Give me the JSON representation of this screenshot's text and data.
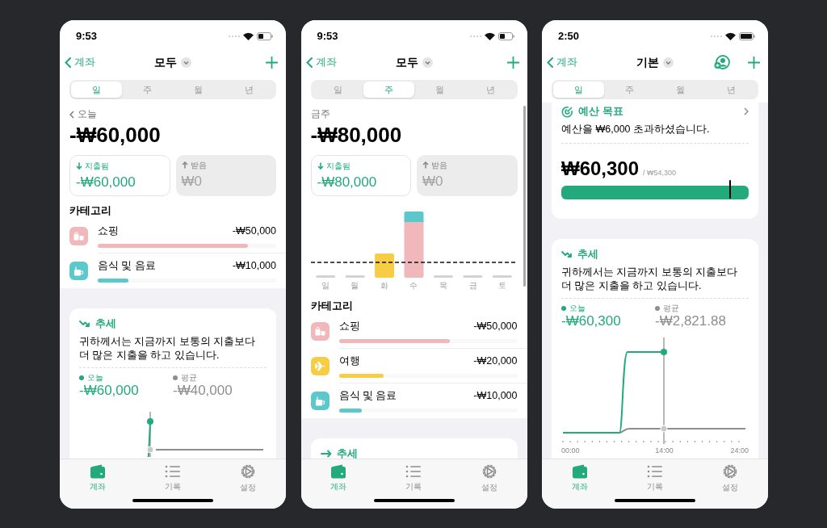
{
  "phones": [
    {
      "status_time": "9:53",
      "battery_full": false,
      "nav": {
        "back": "계좌",
        "title": "모두"
      },
      "segments": [
        {
          "label": "일",
          "selected": true
        },
        {
          "label": "주",
          "selected": false
        },
        {
          "label": "월",
          "selected": false
        },
        {
          "label": "년",
          "selected": false
        }
      ],
      "sections": [
        {
          "kind": "summary",
          "period": "오늘",
          "period_chevron": true,
          "total": "-₩60,000",
          "spent": {
            "label": "지출됨",
            "value": "-₩60,000"
          },
          "received": {
            "label": "받음",
            "value": "₩0"
          }
        },
        {
          "kind": "categories",
          "title": "카테고리",
          "items": [
            {
              "kind": "shopping",
              "name": "쇼핑",
              "amount": "-₩50,000",
              "level": 0.84,
              "color": "#f0b8bb"
            },
            {
              "kind": "food",
              "name": "음식 및 음료",
              "amount": "-₩10,000",
              "level": 0.17,
              "color": "#5cc8cc"
            }
          ]
        },
        {
          "kind": "trend",
          "icon": {
            "kind": "falling"
          },
          "title": "추세",
          "message": "귀하께서는 지금까지 보통의 지출보다 더 많은 지출을 하고 있습니다.",
          "today": {
            "label": "오늘",
            "value": "-₩60,000"
          },
          "average": {
            "label": "평균",
            "value": "-₩40,000"
          },
          "chart": {
            "kind": "spike"
          }
        }
      ],
      "tabs": [
        {
          "label": "계좌",
          "selected": true
        },
        {
          "label": "기록",
          "selected": false
        },
        {
          "label": "설정",
          "selected": false
        }
      ]
    },
    {
      "status_time": "9:53",
      "battery_full": false,
      "scrollbar_visible": true,
      "nav": {
        "back": "계좌",
        "title": "모두"
      },
      "segments": [
        {
          "label": "일",
          "selected": false
        },
        {
          "label": "주",
          "selected": true
        },
        {
          "label": "월",
          "selected": false
        },
        {
          "label": "년",
          "selected": false
        }
      ],
      "sections": [
        {
          "kind": "summary",
          "period": "금주",
          "total": "-₩80,000",
          "spent": {
            "label": "지출됨",
            "value": "-₩80,000"
          },
          "received": {
            "label": "받음",
            "value": "₩0"
          }
        },
        {
          "kind": "week_chart",
          "days": [
            "일",
            "월",
            "화",
            "수",
            "목",
            "금",
            "토"
          ]
        },
        {
          "kind": "categories",
          "title": "카테고리",
          "items": [
            {
              "kind": "shopping",
              "name": "쇼핑",
              "amount": "-₩50,000",
              "level": 0.62,
              "color": "#f0b8bb"
            },
            {
              "kind": "travel",
              "name": "여행",
              "amount": "-₩20,000",
              "level": 0.25,
              "color": "#f7cd45"
            },
            {
              "kind": "food",
              "name": "음식 및 음료",
              "amount": "-₩10,000",
              "level": 0.13,
              "color": "#5cc8cc"
            }
          ]
        },
        {
          "kind": "trend",
          "icon": {
            "kind": "flat"
          },
          "title": "추세"
        }
      ],
      "tabs": [
        {
          "label": "계좌",
          "selected": true
        },
        {
          "label": "기록",
          "selected": false
        },
        {
          "label": "설정",
          "selected": false
        }
      ]
    },
    {
      "status_time": "2:50",
      "battery_full": true,
      "nav": {
        "back": "계좌",
        "title": "기본",
        "person_button": true
      },
      "segments": [
        {
          "label": "일",
          "selected": true
        },
        {
          "label": "주",
          "selected": false
        },
        {
          "label": "월",
          "selected": false
        },
        {
          "label": "년",
          "selected": false
        }
      ],
      "sections": [
        {
          "kind": "budget",
          "title": "예산 목표",
          "message": "예산을 ₩6,000 초과하셨습니다.",
          "spent": "₩60,300",
          "budget": "/ ₩54,300",
          "level": 1
        },
        {
          "kind": "trend",
          "icon": {
            "kind": "falling"
          },
          "title": "추세",
          "message": "귀하께서는 지금까지 보통의 지출보다 더 많은 지출을 하고 있습니다.",
          "today": {
            "label": "오늘",
            "value": "-₩60,300"
          },
          "average": {
            "label": "평균",
            "value": "-₩2,821.88"
          },
          "chart": {
            "kind": "step",
            "x_labels": [
              "00:00",
              "14:00",
              "24:00"
            ]
          }
        }
      ],
      "tabs": [
        {
          "label": "계좌",
          "selected": true
        },
        {
          "label": "기록",
          "selected": false
        },
        {
          "label": "설정",
          "selected": false
        }
      ]
    }
  ]
}
